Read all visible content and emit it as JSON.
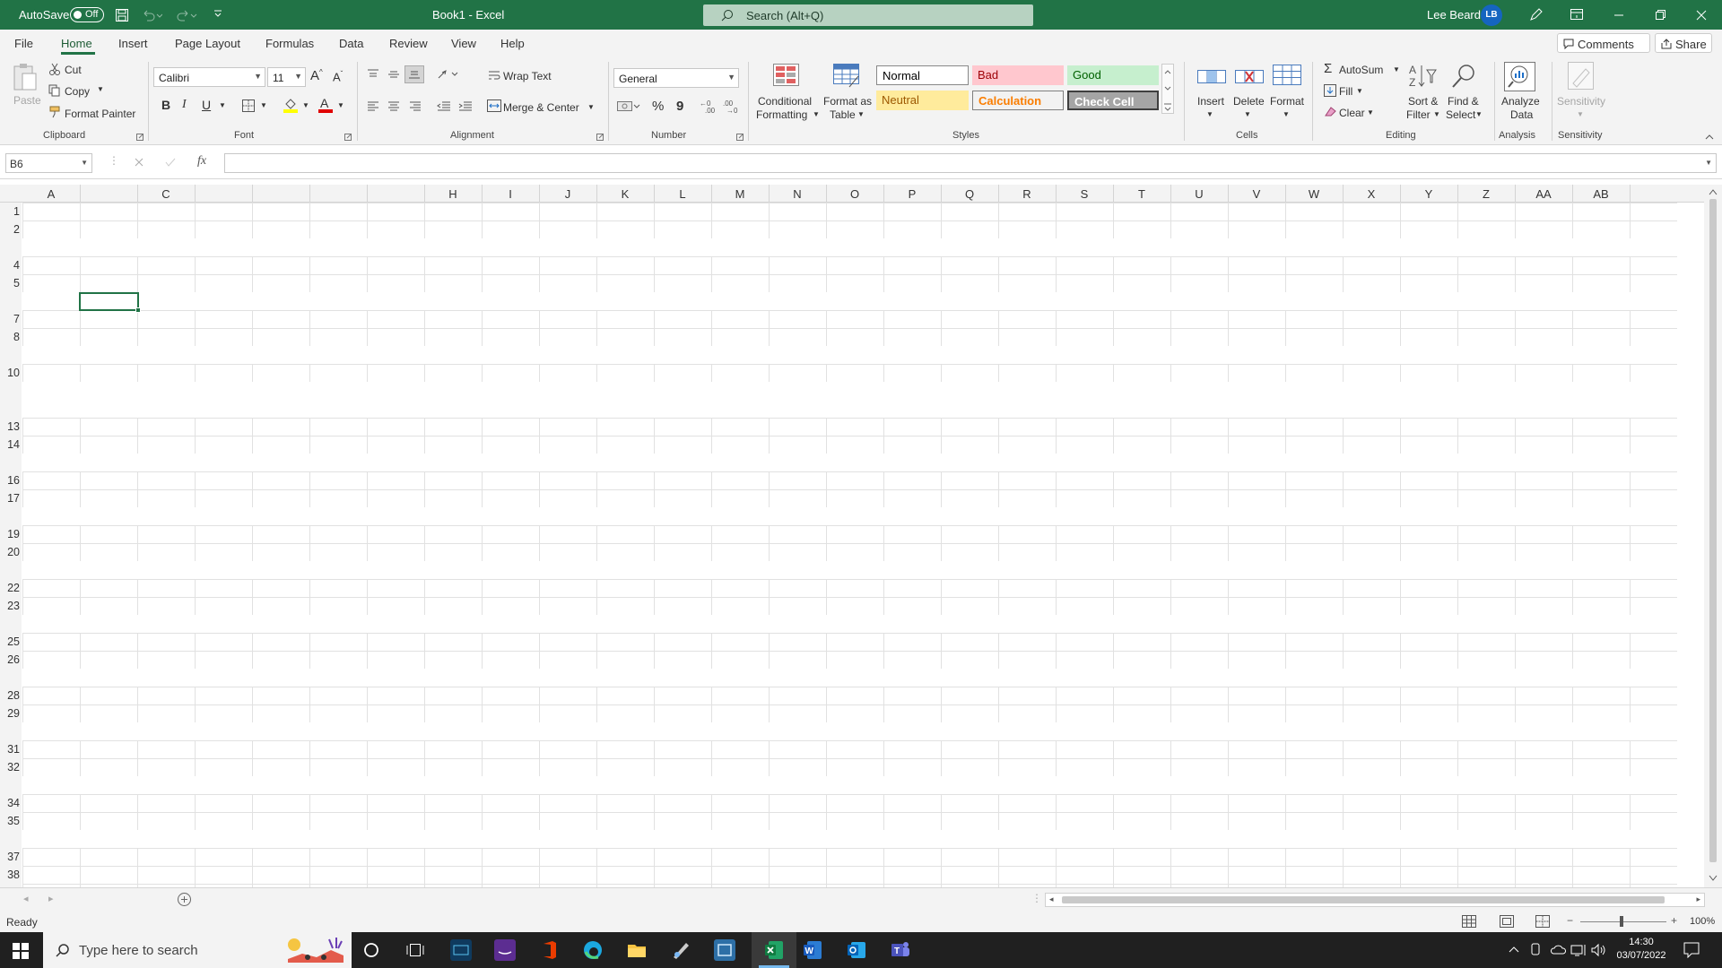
{
  "titlebar": {
    "autosave_label": "AutoSave",
    "autosave_state": "Off",
    "doc_title": "Book1  -  Excel",
    "search_placeholder": "Search (Alt+Q)",
    "user_name": "Lee Beard",
    "user_initials": "LB"
  },
  "menu": {
    "tabs": [
      "File",
      "Home",
      "Insert",
      "Page Layout",
      "Formulas",
      "Data",
      "Review",
      "View",
      "Help"
    ],
    "active": "Home",
    "comments_label": "Comments",
    "share_label": "Share"
  },
  "ribbon": {
    "clipboard": {
      "label": "Clipboard",
      "paste": "Paste",
      "cut": "Cut",
      "copy": "Copy",
      "format_painter": "Format Painter"
    },
    "font": {
      "label": "Font",
      "family": "Calibri",
      "size": "11",
      "bold": "B",
      "italic": "I",
      "underline": "U"
    },
    "alignment": {
      "label": "Alignment",
      "wrap_text": "Wrap Text",
      "merge_center": "Merge & Center"
    },
    "number": {
      "label": "Number",
      "format": "General",
      "percent": "%",
      "comma": "9"
    },
    "styles": {
      "label": "Styles",
      "cond_format_1": "Conditional",
      "cond_format_2": "Formatting",
      "format_table_1": "Format as",
      "format_table_2": "Table",
      "normal": "Normal",
      "bad": "Bad",
      "good": "Good",
      "neutral": "Neutral",
      "calculation": "Calculation",
      "check_cell": "Check Cell"
    },
    "cells": {
      "label": "Cells",
      "insert": "Insert",
      "delete": "Delete",
      "format": "Format"
    },
    "editing": {
      "label": "Editing",
      "autosum": "AutoSum",
      "fill": "Fill",
      "clear": "Clear",
      "sort_1": "Sort &",
      "sort_2": "Filter",
      "find_1": "Find &",
      "find_2": "Select"
    },
    "analysis": {
      "label": "Analysis",
      "analyze_1": "Analyze",
      "analyze_2": "Data"
    },
    "sensitivity": {
      "label": "Sensitivity",
      "btn": "Sensitivity"
    }
  },
  "formula_bar": {
    "name_box": "B6",
    "fx": "fx",
    "value": ""
  },
  "grid": {
    "columns": [
      "A",
      "",
      "C",
      "",
      "",
      "",
      "",
      "H",
      "I",
      "J",
      "K",
      "L",
      "M",
      "N",
      "O",
      "P",
      "Q",
      "R",
      "S",
      "T",
      "U",
      "V",
      "W",
      "X",
      "Y",
      "Z",
      "AA",
      "AB"
    ],
    "rows": [
      "1",
      "2",
      "",
      "4",
      "5",
      "",
      "7",
      "8",
      "",
      "10",
      "",
      "",
      "13",
      "14",
      "",
      "16",
      "17",
      "",
      "19",
      "20",
      "",
      "22",
      "23",
      "",
      "25",
      "26",
      "",
      "28",
      "29",
      "",
      "31",
      "32",
      "",
      "34",
      "35",
      "",
      "37",
      "38"
    ],
    "selected_cell": "B6"
  },
  "status": {
    "ready": "Ready",
    "zoom": "100%"
  },
  "taskbar": {
    "search_placeholder": "Type here to search",
    "time": "14:30",
    "date": "03/07/2022"
  }
}
